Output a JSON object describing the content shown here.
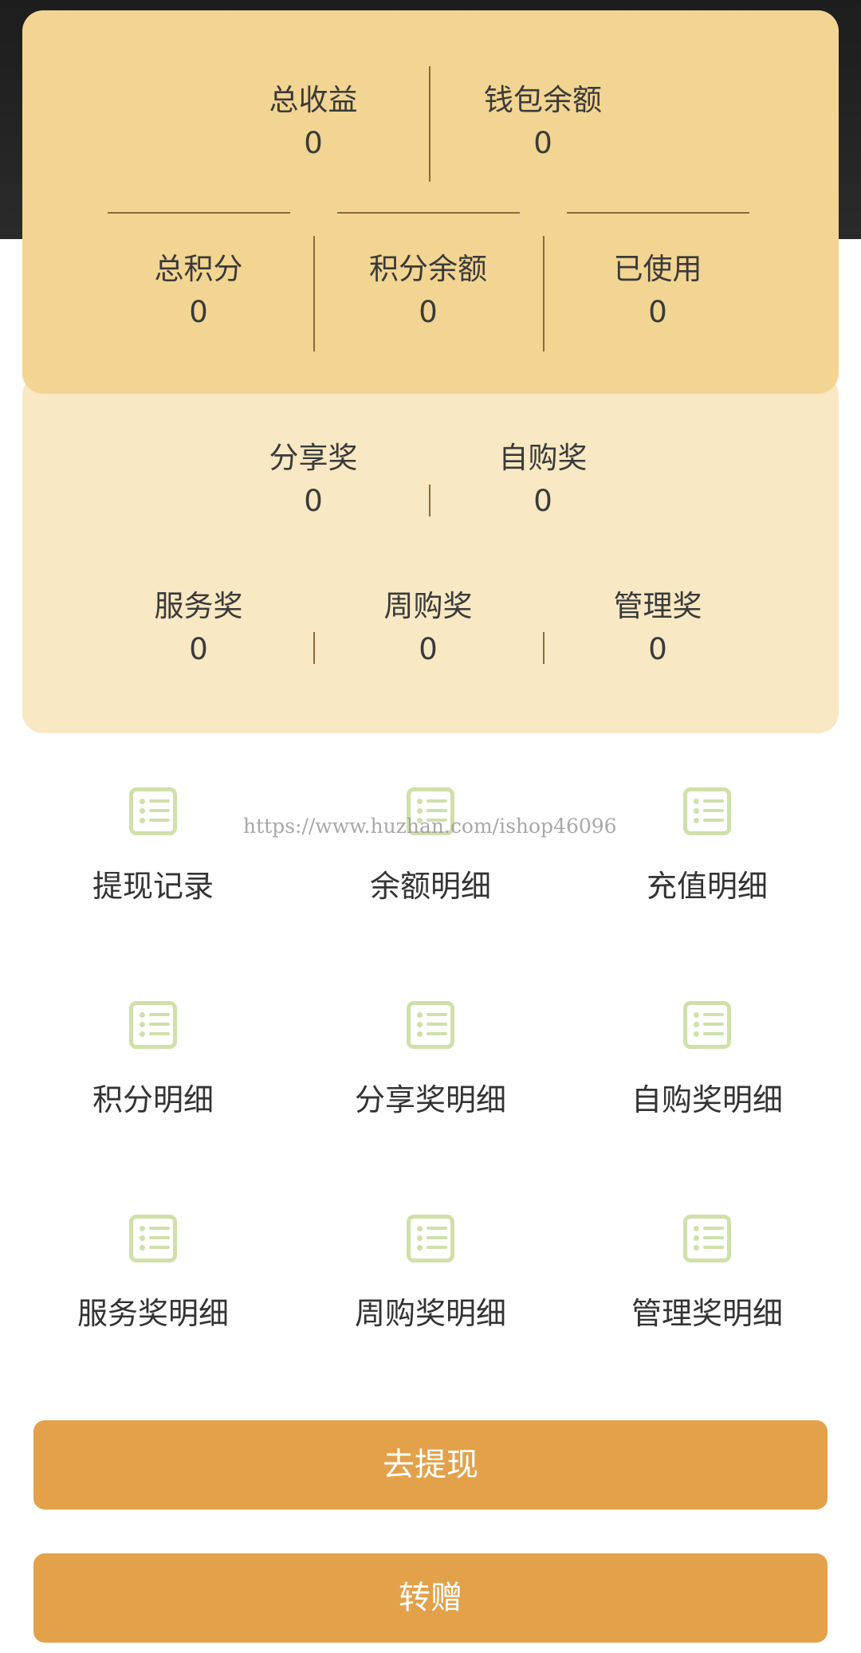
{
  "summary_top": {
    "total_income": {
      "label": "总收益",
      "value": "0"
    },
    "wallet_balance": {
      "label": "钱包余额",
      "value": "0"
    },
    "total_points": {
      "label": "总积分",
      "value": "0"
    },
    "points_balance": {
      "label": "积分余额",
      "value": "0"
    },
    "used": {
      "label": "已使用",
      "value": "0"
    }
  },
  "summary_bottom": {
    "share_reward": {
      "label": "分享奖",
      "value": "0"
    },
    "self_purchase_reward": {
      "label": "自购奖",
      "value": "0"
    },
    "service_reward": {
      "label": "服务奖",
      "value": "0"
    },
    "weekly_purchase_reward": {
      "label": "周购奖",
      "value": "0"
    },
    "management_reward": {
      "label": "管理奖",
      "value": "0"
    }
  },
  "menu": [
    {
      "label": "提现记录",
      "icon": "list-icon"
    },
    {
      "label": "余额明细",
      "icon": "list-icon"
    },
    {
      "label": "充值明细",
      "icon": "list-icon"
    },
    {
      "label": "积分明细",
      "icon": "list-icon"
    },
    {
      "label": "分享奖明细",
      "icon": "list-icon"
    },
    {
      "label": "自购奖明细",
      "icon": "list-icon"
    },
    {
      "label": "服务奖明细",
      "icon": "list-icon"
    },
    {
      "label": "周购奖明细",
      "icon": "list-icon"
    },
    {
      "label": "管理奖明细",
      "icon": "list-icon"
    }
  ],
  "watermark": "https://www.huzhan.com/ishop46096",
  "buttons": {
    "withdraw": "去提现",
    "transfer": "转赠"
  },
  "colors": {
    "card_top": "#f2d592",
    "card_bottom": "#f8e8c3",
    "icon": "#cfe0a9",
    "button": "#e3a14a",
    "divider": "#8a6a3a"
  }
}
